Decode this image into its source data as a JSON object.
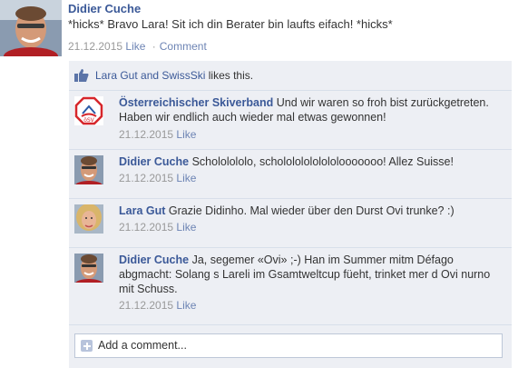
{
  "post": {
    "author": "Didier Cuche",
    "text": "*hicks* Bravo Lara! Sit ich din Berater bin laufts eifach! *hicks*",
    "date": "21.12.2015",
    "like_label": "Like",
    "comment_label": "Comment",
    "separator": "·"
  },
  "likes": {
    "names": "Lara Gut and SwissSki",
    "suffix": "likes this."
  },
  "comments": [
    {
      "author": "Österreichischer Skiverband",
      "text": "Und wir waren so froh bist zurückgetreten. Haben wir endlich auch wieder mal etwas gewonnen!",
      "date": "21.12.2015",
      "like_label": "Like"
    },
    {
      "author": "Didier Cuche",
      "text": "Schololololo, scholololololololooooooo! Allez Suisse!",
      "date": "21.12.2015",
      "like_label": "Like"
    },
    {
      "author": "Lara Gut",
      "text": "Grazie Didinho. Mal wieder über den Durst Ovi trunke? :)",
      "date": "21.12.2015",
      "like_label": "Like"
    },
    {
      "author": "Didier Cuche",
      "text": "Ja, segemer «Ovi» ;-) Han im Summer mitm Défago abgmacht: Solang s Lareli im Gsamtweltcup füeht, trinket mer d Ovi nurno mit Schuss.",
      "date": "21.12.2015",
      "like_label": "Like"
    }
  ],
  "add_comment": {
    "placeholder": "Add a comment..."
  },
  "colors": {
    "link": "#3b5998",
    "feedback_bg": "#edeff4",
    "meta": "#999999"
  }
}
